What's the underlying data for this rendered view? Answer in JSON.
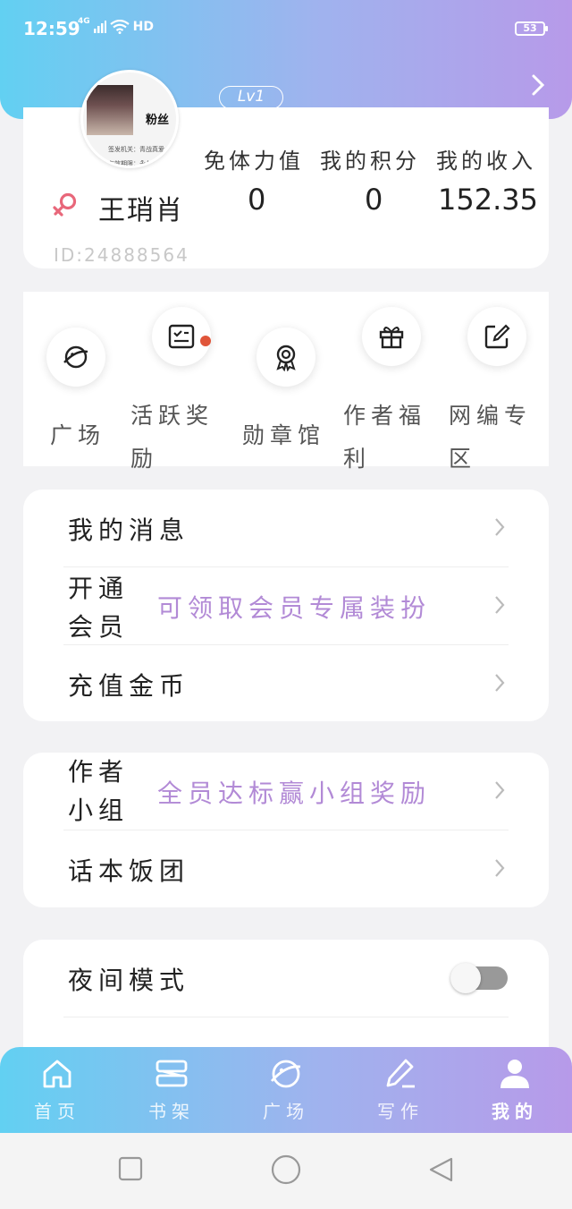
{
  "status_bar": {
    "time": "12:59",
    "network": "4G",
    "hd": "HD",
    "battery": "53"
  },
  "profile": {
    "avatar_text": "粉丝",
    "avatar_small_1": "签发机关：青战真爱",
    "avatar_small_2": "有效期限：永久",
    "level": "Lv1",
    "username": "王琑肖",
    "user_id": "ID:24888564",
    "stats": [
      {
        "label": "免体力值",
        "value": "0"
      },
      {
        "label": "我的积分",
        "value": "0"
      },
      {
        "label": "我的收入",
        "value": "152.35"
      }
    ]
  },
  "features": [
    {
      "label": "广场",
      "icon": "planet-icon",
      "has_dot": false
    },
    {
      "label": "活跃奖励",
      "icon": "checklist-icon",
      "has_dot": true
    },
    {
      "label": "勋章馆",
      "icon": "medal-icon",
      "has_dot": false
    },
    {
      "label": "作者福利",
      "icon": "gift-icon",
      "has_dot": false
    },
    {
      "label": "网编专区",
      "icon": "edit-icon",
      "has_dot": false
    }
  ],
  "menu_group_1": [
    {
      "label": "我的消息",
      "hint": ""
    },
    {
      "label": "开通会员",
      "hint": "可领取会员专属装扮"
    },
    {
      "label": "充值金币",
      "hint": ""
    }
  ],
  "menu_group_2": [
    {
      "label": "作者小组",
      "hint": "全员达标赢小组奖励"
    },
    {
      "label": "话本饭团",
      "hint": ""
    }
  ],
  "menu_group_3": [
    {
      "label": "夜间模式",
      "toggle": false
    }
  ],
  "tabbar": [
    {
      "label": "首页",
      "icon": "home-icon",
      "active": false
    },
    {
      "label": "书架",
      "icon": "bookshelf-icon",
      "active": false
    },
    {
      "label": "广场",
      "icon": "planet-icon",
      "active": false
    },
    {
      "label": "写作",
      "icon": "pen-icon",
      "active": false
    },
    {
      "label": "我的",
      "icon": "person-icon",
      "active": true
    }
  ],
  "colors": {
    "gradient_start": "#62d0f2",
    "gradient_end": "#b79ae9",
    "hint_purple": "#b28ad6",
    "dot_red": "#e0553a",
    "gender_pink": "#e8677a"
  }
}
